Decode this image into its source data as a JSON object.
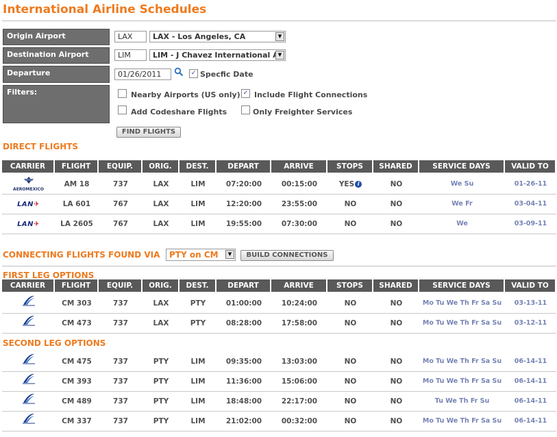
{
  "page": {
    "title": "International Airline Schedules"
  },
  "form": {
    "origin_label": "Origin Airport",
    "origin_code": "LAX",
    "origin_select": "LAX - Los Angeles, CA",
    "destination_label": "Destination Airport",
    "destination_code": "LIM",
    "destination_select": "LIM - J Chavez International A",
    "departure_label": "Departure",
    "departure_date": "01/26/2011",
    "specific_date_label": "Specfic Date",
    "filters_label": "Filters:",
    "filters": {
      "nearby": "Nearby Airports (US only)",
      "connections": "Include Flight Connections",
      "codeshare": "Add Codeshare Flights",
      "freighter": "Only Freighter Services"
    },
    "find_button": "FIND FLIGHTS"
  },
  "columns": [
    "CARRIER",
    "FLIGHT",
    "EQUIP.",
    "ORIG.",
    "DEST.",
    "DEPART",
    "ARRIVE",
    "STOPS",
    "SHARED",
    "SERVICE DAYS",
    "VALID TO"
  ],
  "direct": {
    "title": "DIRECT FLIGHTS",
    "rows": [
      {
        "carrier": "AeroMexico",
        "flight": "AM 18",
        "equip": "737",
        "orig": "LAX",
        "dest": "LIM",
        "depart": "07:20:00",
        "arrive": "00:15:00",
        "stops": "YES",
        "shared": "NO",
        "days": "We Su",
        "valid": "01-26-11"
      },
      {
        "carrier": "LAN",
        "flight": "LA 601",
        "equip": "767",
        "orig": "LAX",
        "dest": "LIM",
        "depart": "12:20:00",
        "arrive": "23:55:00",
        "stops": "NO",
        "shared": "NO",
        "days": "We Fr",
        "valid": "03-04-11"
      },
      {
        "carrier": "LAN",
        "flight": "LA 2605",
        "equip": "767",
        "orig": "LAX",
        "dest": "LIM",
        "depart": "19:55:00",
        "arrive": "07:30:00",
        "stops": "NO",
        "shared": "NO",
        "days": "We",
        "valid": "03-09-11"
      }
    ]
  },
  "connecting": {
    "title": "CONNECTING FLIGHTS FOUND VIA",
    "via_select": "PTY on CM",
    "build_button": "BUILD CONNECTIONS"
  },
  "first_leg": {
    "title": "FIRST LEG OPTIONS",
    "rows": [
      {
        "flight": "CM 303",
        "equip": "737",
        "orig": "LAX",
        "dest": "PTY",
        "depart": "01:00:00",
        "arrive": "10:24:00",
        "stops": "NO",
        "shared": "NO",
        "days": "Mo Tu We Th Fr Sa Su",
        "valid": "03-13-11"
      },
      {
        "flight": "CM 473",
        "equip": "737",
        "orig": "LAX",
        "dest": "PTY",
        "depart": "08:28:00",
        "arrive": "17:58:00",
        "stops": "NO",
        "shared": "NO",
        "days": "Mo Tu We Th Fr Sa Su",
        "valid": "03-12-11"
      }
    ]
  },
  "second_leg": {
    "title": "SECOND LEG OPTIONS",
    "rows": [
      {
        "flight": "CM 475",
        "equip": "737",
        "orig": "PTY",
        "dest": "LIM",
        "depart": "09:35:00",
        "arrive": "13:03:00",
        "stops": "NO",
        "shared": "NO",
        "days": "Mo Tu We Th Fr Sa Su",
        "valid": "06-14-11"
      },
      {
        "flight": "CM 393",
        "equip": "737",
        "orig": "PTY",
        "dest": "LIM",
        "depart": "11:36:00",
        "arrive": "15:06:00",
        "stops": "NO",
        "shared": "NO",
        "days": "Mo Tu We Th Fr Sa Su",
        "valid": "06-14-11"
      },
      {
        "flight": "CM 489",
        "equip": "737",
        "orig": "PTY",
        "dest": "LIM",
        "depart": "18:48:00",
        "arrive": "22:17:00",
        "stops": "NO",
        "shared": "NO",
        "days": "Tu We Th Fr Su",
        "valid": "06-14-11"
      },
      {
        "flight": "CM 337",
        "equip": "737",
        "orig": "PTY",
        "dest": "LIM",
        "depart": "21:02:00",
        "arrive": "00:32:00",
        "stops": "NO",
        "shared": "NO",
        "days": "Mo Tu We Th Fr Sa Su",
        "valid": "06-14-11"
      }
    ]
  },
  "colors": {
    "accent": "#ee7a1e",
    "header_bg": "#595959",
    "label_bg": "#6e6e6e",
    "days": "#7683b5"
  }
}
